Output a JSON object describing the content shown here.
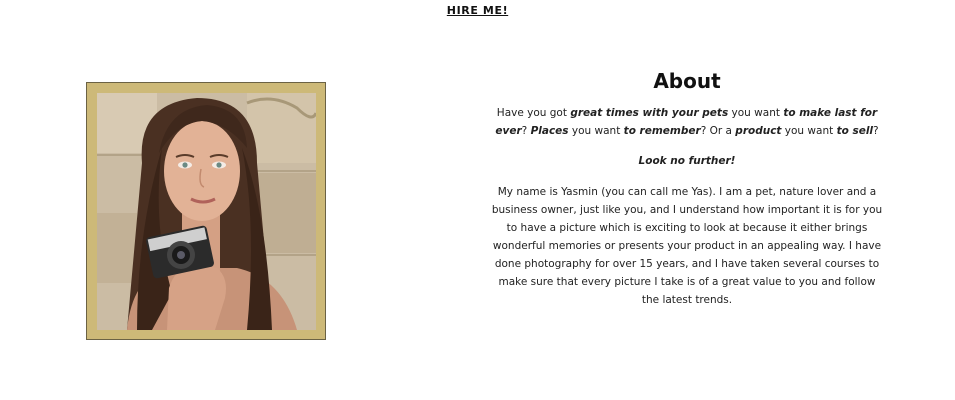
{
  "nav": {
    "hire_label": "HIRE ME!"
  },
  "about": {
    "title": "About",
    "intro": {
      "t1": "Have you got ",
      "b1": "great times with your pets",
      "t2": " you want ",
      "b2": "to make last for ever",
      "t3": "? ",
      "b3": "Places",
      "t4": " you want ",
      "b4": "to remember",
      "t5": "? Or a ",
      "b5": "product",
      "t6": " you want ",
      "b6": "to sell",
      "t7": "?"
    },
    "look": "Look no further!",
    "body": "My name is Yasmin (you can call me Yas). I am a pet, nature lover and a business owner, just like you, and I understand how important it is for you to have a picture which is exciting to look at because it either brings wonderful memories or presents your product in an appealing way. I have done photography for over 15 years, and I have taken several courses to make sure that every picture I take is of a great value to you and follow the latest trends."
  },
  "colors": {
    "frame": "#cdb978",
    "frame_border": "#6b6244"
  }
}
